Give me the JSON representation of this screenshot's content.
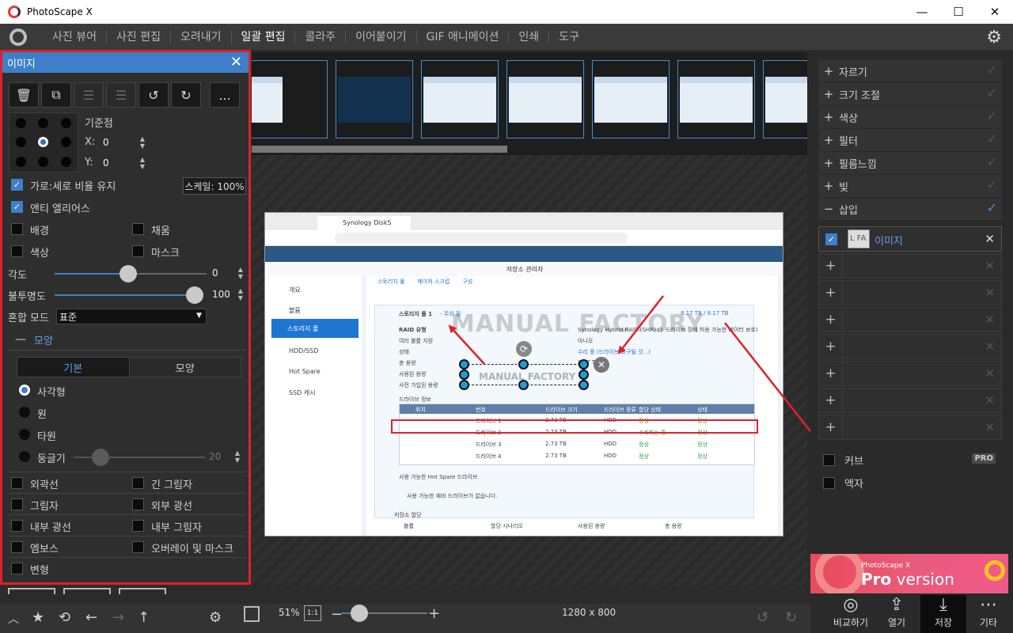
{
  "window": {
    "title": "PhotoScape X",
    "min": "—",
    "max": "☐",
    "close": "✕"
  },
  "menu": [
    {
      "label": "사진 뷰어"
    },
    {
      "label": "사진 편집"
    },
    {
      "label": "오려내기"
    },
    {
      "label": "일괄 편집",
      "active": true
    },
    {
      "label": "콜라주"
    },
    {
      "label": "이어붙이기"
    },
    {
      "label": "GIF 애니메이션"
    },
    {
      "label": "인쇄"
    },
    {
      "label": "도구"
    }
  ],
  "panel": {
    "title": "이미지",
    "more": "...",
    "anchor_label": "기준점",
    "x_label": "X:",
    "x_value": "0",
    "y_label": "Y:",
    "y_value": "0",
    "keep_ratio": "가로:세로 비율 유지",
    "scale": "스케일: 100%",
    "antialias": "앤티 앨리어스",
    "background": "배경",
    "fill": "채움",
    "color": "색상",
    "mask": "마스크",
    "angle_label": "각도",
    "angle_value": "0",
    "opacity_label": "불투명도",
    "opacity_value": "100",
    "blend_label": "혼합 모드",
    "blend_value": "표준",
    "shape_section": "모양",
    "tab_basic": "기본",
    "tab_shape": "모양",
    "shape_rect": "사각형",
    "shape_circle": "원",
    "shape_ellipse": "타원",
    "shape_round": "둥글기",
    "round_value": "20",
    "outline": "외곽선",
    "long_shadow": "긴 그림자",
    "shadow": "그림자",
    "outer_glow": "외부 광선",
    "inner_glow": "내부 광선",
    "inner_shadow": "내부 그림자",
    "emboss": "엠보스",
    "overlay_mask": "오버레이 및 마스크",
    "transform": "변형"
  },
  "screenshot": {
    "tab_title": "Synology DiskS",
    "window_title": "저장소 관리자",
    "watermark": "MANUAL FACTORY",
    "watermark_small": "MANUAL FACTORY",
    "side_items": [
      "개요",
      "볼륨",
      "스토리지 풀",
      "HDD/SSD",
      "Hot Spare",
      "SSD 캐시"
    ],
    "main_tabs": [
      "스토리지 풀",
      "메이저 스크럽",
      "구성"
    ],
    "pool_title": "스토리지 풀 1",
    "pool_status_link": "- 주의 필",
    "capacity": "8.17 TB / 8.17 TB",
    "raid_label": "RAID 유형",
    "raid_value": "Synology Hybrid RAID (SHR) (1-드라이브 장애 허용 가능한 데이터 보호)",
    "multi_label": "여러 볼륨 지원",
    "multi_value": "아니오",
    "state_label": "상태",
    "state_value": "수리 중 (드라이브 요구될 것...)",
    "total_label": "총 용량",
    "total_value": "8.17 TB",
    "used_label": "사용된 용량",
    "alloc_label": "사전 가입된 용량",
    "drive_info": "드라이브 정보",
    "drive_cols": [
      "위치",
      "번호",
      "드라이브 크기",
      "드라이브 종류",
      "할당 상태",
      "상태"
    ],
    "drives": [
      {
        "name": "드라이브 1",
        "size": "2.73 TB",
        "type": "HDD",
        "alloc": "정상",
        "status": "정상"
      },
      {
        "name": "드라이브 2",
        "size": "2.73 TB",
        "type": "HDD",
        "alloc": "수리하는 중",
        "status": "정상"
      },
      {
        "name": "드라이브 3",
        "size": "2.73 TB",
        "type": "HDD",
        "alloc": "정상",
        "status": "정상"
      },
      {
        "name": "드라이브 4",
        "size": "2.73 TB",
        "type": "HDD",
        "alloc": "정상",
        "status": "정상"
      }
    ],
    "hotspare_title": "사용 가능한 Hot Spare 드라이브",
    "hotspare_empty": "사용 가능한 예비 드라이브가 없습니다.",
    "alloc_title": "저장소 할당",
    "alloc_cols": [
      "볼륨",
      "할당 시나리오",
      "사용된 용량",
      "총 용량"
    ]
  },
  "right_panel": {
    "items": [
      {
        "label": "자르기",
        "on": false
      },
      {
        "label": "크기 조절",
        "on": false
      },
      {
        "label": "색상",
        "on": false
      },
      {
        "label": "필터",
        "on": false
      },
      {
        "label": "필름느낌",
        "on": false
      },
      {
        "label": "빛",
        "on": false
      },
      {
        "label": "삽입",
        "on": true
      }
    ],
    "insert_image_label": "이미지",
    "insert_image_thumb": "L FA",
    "cover": "커브",
    "pro": "PRO",
    "frame": "액자"
  },
  "ad": {
    "small": "PhotoScape X",
    "big_bold": "Pro",
    "big_rest": " version"
  },
  "bottom": {
    "zoom": "51%",
    "fit": "1:1",
    "dimensions": "1280 x 800",
    "compare": "비교하기",
    "open": "열기",
    "save": "저장",
    "more": "기타"
  }
}
